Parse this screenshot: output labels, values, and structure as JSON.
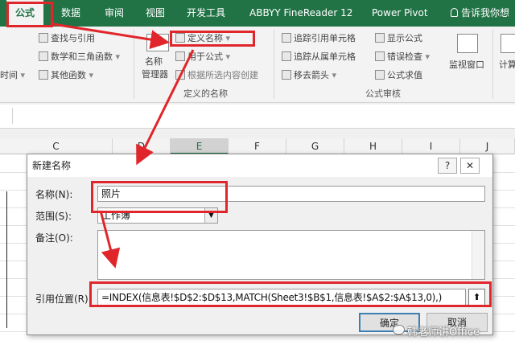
{
  "tabs": [
    {
      "label": "公式",
      "active": true
    },
    {
      "label": "数据"
    },
    {
      "label": "审阅"
    },
    {
      "label": "视图"
    },
    {
      "label": "开发工具"
    },
    {
      "label": "ABBYY FineReader 12"
    },
    {
      "label": "Power Pivot"
    }
  ],
  "tell_me": "告诉我你想",
  "ribbon": {
    "func_lib": {
      "lookup": "查找与引用",
      "math": "数学和三角函数",
      "other": "其他函数",
      "datetime": "时间"
    },
    "names": {
      "manager_line1": "名称",
      "manager_line2": "管理器",
      "define_name": "定义名称",
      "use_in_formula": "用于公式",
      "create_from_selection": "根据所选内容创建",
      "group_label": "定义的名称"
    },
    "audit": {
      "trace_precedents": "追踪引用单元格",
      "trace_dependents": "追踪从属单元格",
      "remove_arrows": "移去箭头",
      "show_formulas": "显示公式",
      "error_check": "错误检查",
      "evaluate": "公式求值",
      "group_label": "公式审核"
    },
    "watch_window": "监视窗口",
    "calc": "计算"
  },
  "columns": [
    "C",
    "D",
    "E",
    "F",
    "G",
    "H",
    "I",
    "J"
  ],
  "selected_column": "E",
  "dialog": {
    "title": "新建名称",
    "help_btn": "?",
    "close_btn": "✕",
    "name_label": "名称(N):",
    "name_value": "照片",
    "scope_label": "范围(S):",
    "scope_value": "工作簿",
    "comment_label": "备注(O):",
    "comment_value": "",
    "ref_label": "引用位置(R):",
    "ref_value": "=INDEX(信息表!$D$2:$D$13,MATCH(Sheet3!$B$1,信息表!$A$2:$A$13,0),)",
    "ok": "确定",
    "cancel": "取消"
  },
  "watermark": "韩老师讲Office",
  "colors": {
    "excel_green": "#217346",
    "annotation_red": "#e0262b"
  }
}
